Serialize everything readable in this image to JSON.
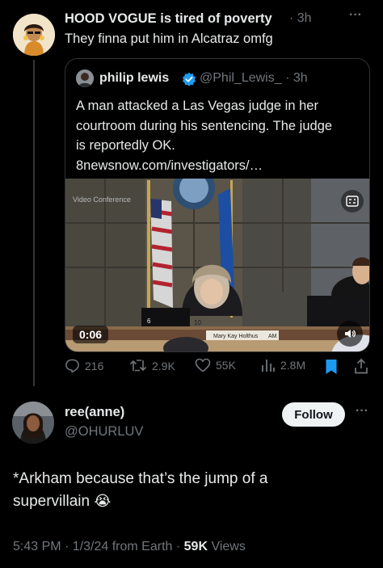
{
  "parent_tweet": {
    "display_name": "HOOD VOGUE is tired of poverty",
    "time": "· 3h",
    "text": "They finna put him in Alcatraz omfg",
    "more_icon": "···"
  },
  "quoted_tweet": {
    "display_name": "philip lewis",
    "handle_time": "@Phil_Lewis_ · 3h",
    "text": "A man attacked a Las Vegas judge in her courtroom during his sentencing. The judge is reportedly OK. 8newsnow.com/investigators/…",
    "video": {
      "duration": "0:06",
      "overlay_caption": "Video Conference",
      "nameplate_text": "Mary Kay Holthus",
      "bench_number_left": "6",
      "bench_number_mid": "10",
      "bench_label_right": "AM"
    }
  },
  "actions": {
    "replies": "216",
    "retweets": "2.9K",
    "likes": "55K",
    "views": "2.8M"
  },
  "reply_tweet": {
    "display_name": "ree(anne)",
    "handle": "@OHURLUV",
    "follow_label": "Follow",
    "text_line1": "*Arkham because that’s the jump of a",
    "text_line2": "supervillain",
    "emoji": "😭",
    "timestamp": "5:43 PM · 1/3/24 from Earth ·",
    "views_count": "59K",
    "views_label": "Views",
    "more_icon": "···"
  },
  "colors": {
    "background": "#000000",
    "text": "#e7e9ea",
    "muted": "#71767b",
    "verified": "#1d9bf0",
    "bookmark": "#1d9bf0"
  }
}
